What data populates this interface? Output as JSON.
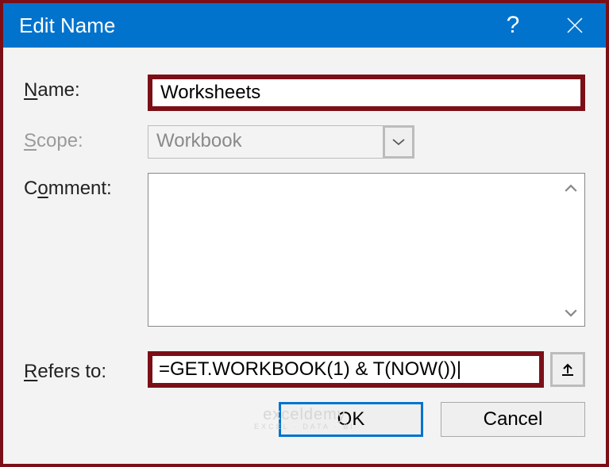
{
  "titlebar": {
    "title": "Edit Name",
    "help": "?",
    "close": "×"
  },
  "labels": {
    "name_prefix": "N",
    "name_rest": "ame:",
    "scope_prefix": "S",
    "scope_rest": "cope:",
    "comment_prefix": "C",
    "comment_middle": "o",
    "comment_rest": "mment:",
    "refers_prefix": "R",
    "refers_rest": "efers to:"
  },
  "fields": {
    "name_value": "Worksheets",
    "scope_value": "Workbook",
    "comment_value": "",
    "refers_value": "=GET.WORKBOOK(1) & T(NOW())|"
  },
  "buttons": {
    "ok": "OK",
    "cancel": "Cancel"
  },
  "watermark": {
    "main": "exceldemy",
    "sub": "EXCEL · DATA · BI"
  }
}
